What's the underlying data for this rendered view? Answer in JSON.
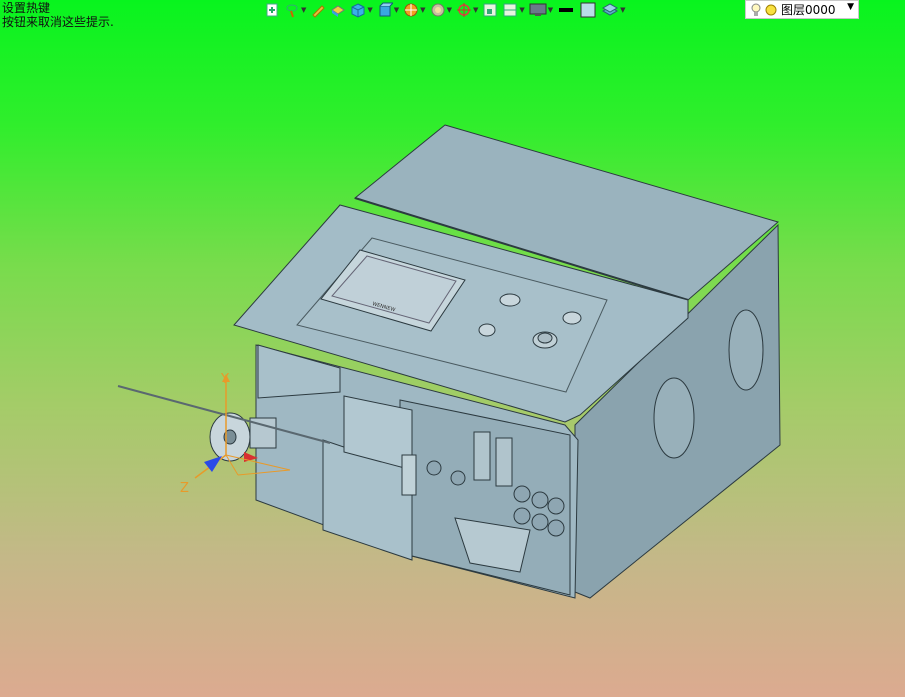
{
  "hint": {
    "line1": "设置热键",
    "line2": "按钮来取消这些提示."
  },
  "toolbar": {
    "icons": [
      "insert-icon",
      "lasso-icon",
      "pen-icon",
      "solid-icon",
      "cube-icon",
      "view-cube-icon",
      "render-icon",
      "section-icon",
      "move-icon",
      "frame-icon",
      "split-icon",
      "monitor-icon",
      "line-color-icon",
      "fill-color-icon",
      "layer-stack-icon"
    ]
  },
  "layer": {
    "name": "图层0000"
  },
  "triad": {
    "y": "Y",
    "z": "Z"
  },
  "colors": {
    "body": "#a2bcc7",
    "body_dark": "#8aa4b0",
    "edge": "#2c3a40",
    "axis_orange": "#e89a2a"
  },
  "machine": {
    "screen_label": "WENNEW"
  }
}
